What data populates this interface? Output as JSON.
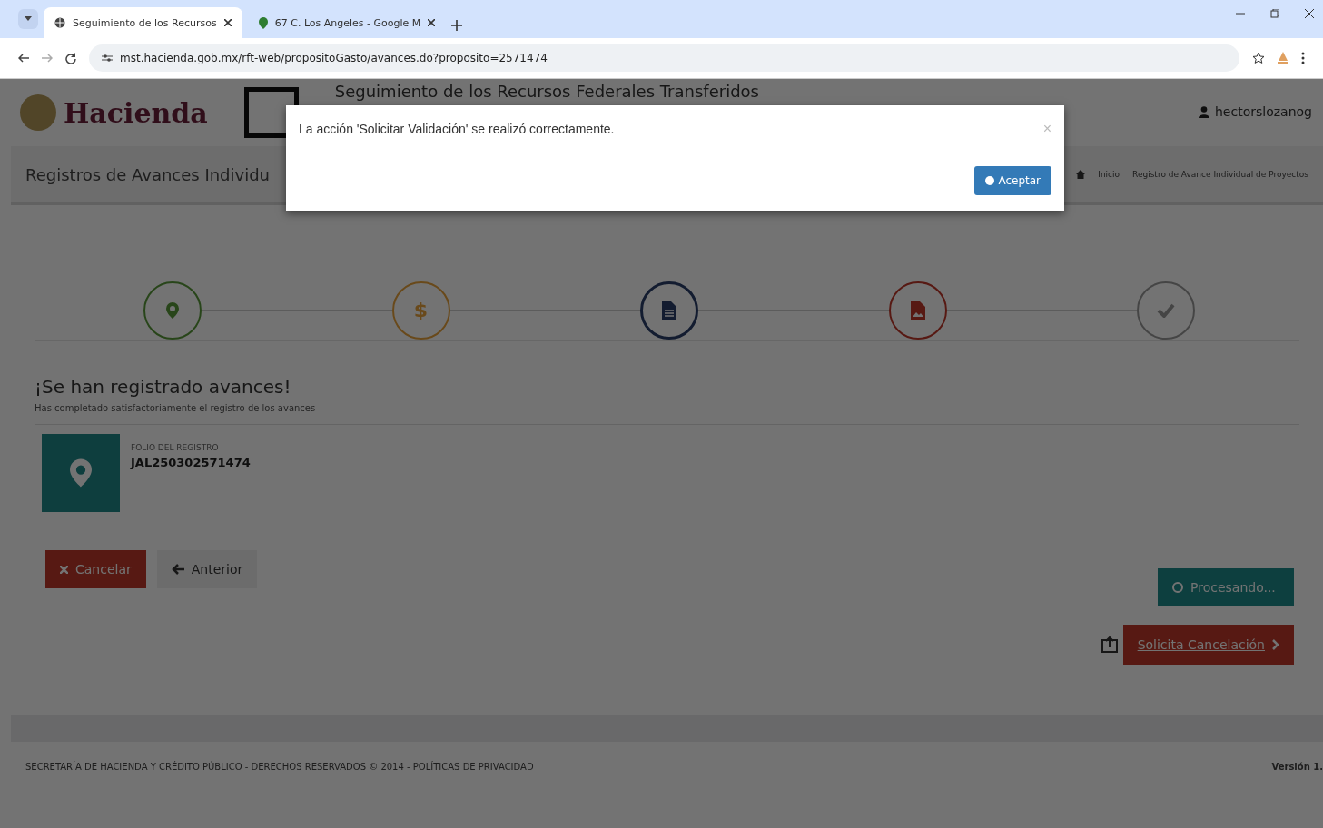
{
  "browser": {
    "tabs": [
      {
        "title": "Seguimiento de los Recursos",
        "selected": true,
        "kind": "globe"
      },
      {
        "title": "67 C. Los Angeles - Google M",
        "selected": false,
        "kind": "pin"
      }
    ],
    "url": "mst.hacienda.gob.mx/rft-web/propositoGasto/avances.do?proposito=2571474"
  },
  "header": {
    "brand": "Hacienda",
    "title": "Seguimiento de los Recursos Federales Transferidos",
    "user": "hectorslozanog"
  },
  "page": {
    "title": "Registros de Avances Individu",
    "breadcrumb": [
      "Inicio",
      "Registro de Avance Individual de Proyectos"
    ]
  },
  "steps": [
    {
      "kind": "pin",
      "selected": false
    },
    {
      "kind": "dollar",
      "symbol": "$",
      "selected": false
    },
    {
      "kind": "file",
      "selected": true
    },
    {
      "kind": "image",
      "selected": false
    },
    {
      "kind": "check",
      "selected": false
    }
  ],
  "result": {
    "heading": "¡Se han registrado avances!",
    "text": "Has completado satisfactoriamente el registro de los avances",
    "folio_label": "FOLIO DEL REGISTRO",
    "folio": "JAL250302571474"
  },
  "buttons": {
    "cancel": "Cancelar",
    "back": "Anterior",
    "processing": "Procesando...",
    "request_cancel": "Solicita Cancelación"
  },
  "footer": {
    "text": "SECRETARÍA DE HACIENDA Y CRÉDITO PÚBLICO - DERECHOS RESERVADOS © 2014 - POLÍTICAS DE PRIVACIDAD",
    "version": "Versión 1."
  },
  "modal": {
    "message": "La acción 'Solicitar Validación' se realizó correctamente.",
    "close": "×",
    "accept": "Aceptar"
  }
}
